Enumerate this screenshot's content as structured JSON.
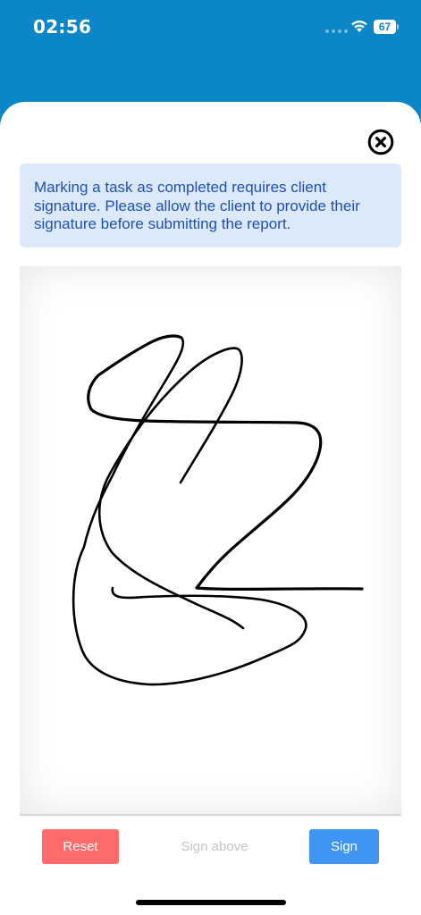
{
  "status_bar": {
    "time": "02:56",
    "battery_level": "67",
    "battery_fraction": 0.67
  },
  "modal": {
    "close_icon": "close-circle-icon",
    "info_message": "Marking a task as completed requires client signature. Please allow the client to provide their signature before submitting the report.",
    "info_background": "#dbe9fb",
    "info_text_color": "#1f4fb8"
  },
  "footer": {
    "reset_label": "Reset",
    "hint_label": "Sign above",
    "sign_label": "Sign",
    "reset_color": "#ff6b6b",
    "sign_color": "#3f95f1"
  },
  "theme": {
    "header_color": "#0b86c8"
  }
}
